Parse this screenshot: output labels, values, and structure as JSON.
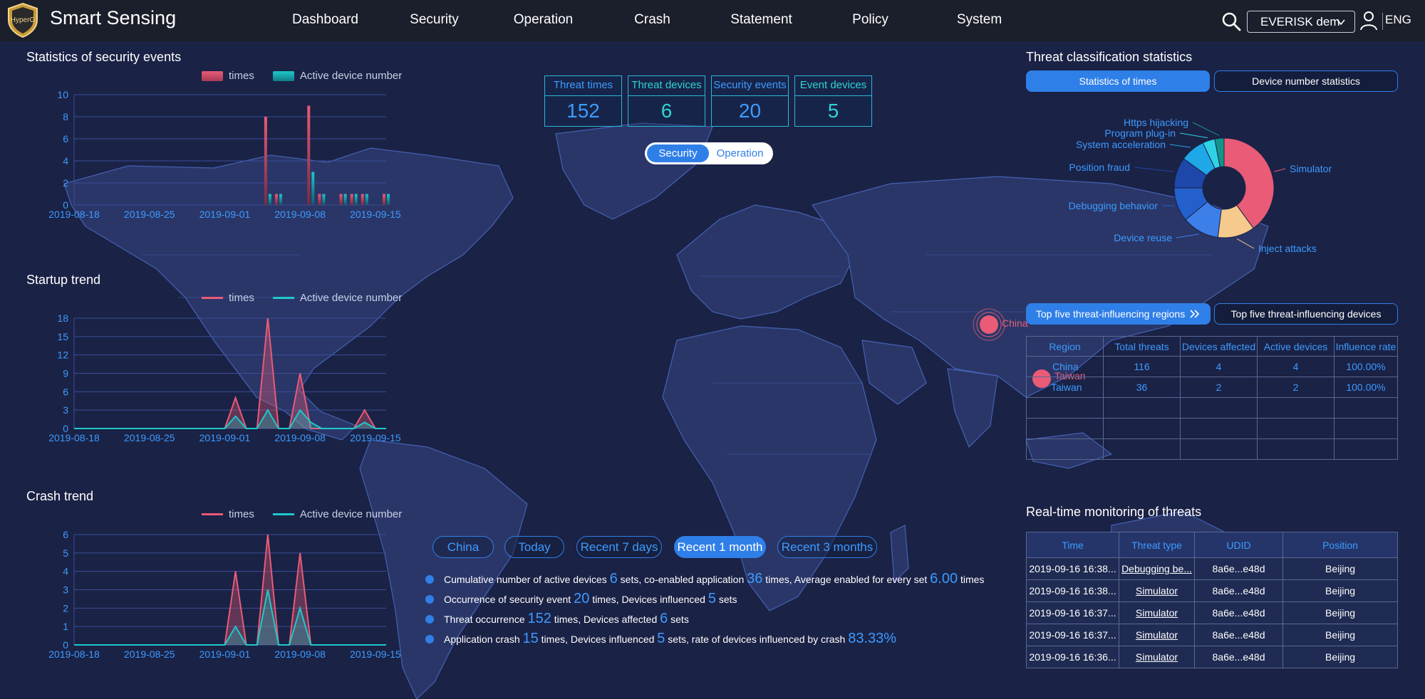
{
  "app": {
    "logo_text": "HyperG",
    "title": "Smart Sensing"
  },
  "nav": [
    "Dashboard",
    "Security",
    "Operation",
    "Crash",
    "Statement",
    "Policy",
    "System"
  ],
  "header": {
    "account": "EVERISK dem",
    "language": "ENG"
  },
  "colors": {
    "times": "#e95b76",
    "active": "#1ec9c9",
    "accent": "#2f7fe8",
    "background": "#1a2246",
    "topbar": "#1b1f2b"
  },
  "icons": [
    "logo-shield-icon",
    "search-icon",
    "chevron-down-icon",
    "user-icon"
  ],
  "sections": {
    "security_events": "Statistics of security events",
    "startup_trend": "Startup trend",
    "crash_trend": "Crash trend",
    "threat_classification": "Threat classification statistics",
    "realtime": "Real-time monitoring of threats"
  },
  "legend": {
    "times": "times",
    "active": "Active device number"
  },
  "kpis": [
    {
      "label": "Threat times",
      "value": "152",
      "style": "blue"
    },
    {
      "label": "Threat devices",
      "value": "6",
      "style": "teal"
    },
    {
      "label": "Security events",
      "value": "20",
      "style": "blue"
    },
    {
      "label": "Event devices",
      "value": "5",
      "style": "teal"
    }
  ],
  "mode_toggle": {
    "active": "Security",
    "inactive": "Operation"
  },
  "classification_tabs": {
    "active": "Statistics of times",
    "inactive": "Device number statistics"
  },
  "influence_tabs": {
    "active": "Top five threat-influencing regions",
    "inactive": "Top five threat-influencing devices"
  },
  "regions_table": {
    "headers": [
      "Region",
      "Total threats",
      "Devices affected",
      "Active devices",
      "Influence rate"
    ],
    "rows": [
      [
        "China",
        "116",
        "4",
        "4",
        "100.00%"
      ],
      [
        "Taiwan",
        "36",
        "2",
        "2",
        "100.00%"
      ],
      [
        "",
        "",
        "",
        "",
        ""
      ],
      [
        "",
        "",
        "",
        "",
        ""
      ],
      [
        "",
        "",
        "",
        "",
        ""
      ]
    ]
  },
  "monitor_table": {
    "headers": [
      "Time",
      "Threat type",
      "UDID",
      "Position"
    ],
    "rows": [
      [
        "2019-09-16 16:38...",
        "Debugging be...",
        "8a6e...e48d",
        "Beijing"
      ],
      [
        "2019-09-16 16:38...",
        "Simulator",
        "8a6e...e48d",
        "Beijing"
      ],
      [
        "2019-09-16 16:37...",
        "Simulator",
        "8a6e...e48d",
        "Beijing"
      ],
      [
        "2019-09-16 16:37...",
        "Simulator",
        "8a6e...e48d",
        "Beijing"
      ],
      [
        "2019-09-16 16:36...",
        "Simulator",
        "8a6e...e48d",
        "Beijing"
      ]
    ]
  },
  "filters": [
    "China",
    "Today",
    "Recent 7 days",
    "Recent 1 month",
    "Recent 3 months"
  ],
  "active_filter": "Recent 1 month",
  "summary": {
    "l1": {
      "a": "Cumulative number of active devices ",
      "n1": "6",
      "b": " sets, co-enabled application ",
      "n2": "36",
      "c": " times, Average enabled for every set ",
      "n3": "6.00",
      "d": " times"
    },
    "l2": {
      "a": "Occurrence of security event ",
      "n1": "20",
      "b": " times, Devices influenced ",
      "n2": "5",
      "c": " sets"
    },
    "l3": {
      "a": "Threat occurrence ",
      "n1": "152",
      "b": " times, Devices affected ",
      "n2": "6",
      "c": " sets"
    },
    "l4": {
      "a": "Application crash ",
      "n1": "15",
      "b": " times, Devices influenced ",
      "n2": "5",
      "c": " sets, rate of devices influenced by crash ",
      "n3": "83.33%"
    }
  },
  "map_markers": [
    {
      "label": "China"
    },
    {
      "label": "Taiwan"
    }
  ],
  "chart_data": [
    {
      "id": "security-events",
      "type": "bar",
      "title": "Statistics of security events",
      "x_tick_labels": [
        "2019-08-18",
        "2019-08-25",
        "2019-09-01",
        "2019-09-08",
        "2019-09-15"
      ],
      "x_range": [
        "2019-08-18",
        "2019-09-16"
      ],
      "ylim": [
        0,
        10
      ],
      "y_ticks": [
        0,
        2,
        4,
        6,
        8,
        10
      ],
      "series": [
        {
          "name": "times",
          "points": [
            [
              "2019-09-05",
              8
            ],
            [
              "2019-09-06",
              1
            ],
            [
              "2019-09-09",
              9
            ],
            [
              "2019-09-10",
              1
            ],
            [
              "2019-09-12",
              1
            ],
            [
              "2019-09-13",
              1
            ],
            [
              "2019-09-14",
              1
            ],
            [
              "2019-09-16",
              1
            ]
          ]
        },
        {
          "name": "Active device number",
          "points": [
            [
              "2019-09-05",
              1
            ],
            [
              "2019-09-06",
              1
            ],
            [
              "2019-09-09",
              3
            ],
            [
              "2019-09-10",
              1
            ],
            [
              "2019-09-12",
              1
            ],
            [
              "2019-09-13",
              1
            ],
            [
              "2019-09-14",
              1
            ],
            [
              "2019-09-16",
              1
            ]
          ]
        }
      ]
    },
    {
      "id": "startup-trend",
      "type": "area",
      "title": "Startup trend",
      "x_tick_labels": [
        "2019-08-18",
        "2019-08-25",
        "2019-09-01",
        "2019-09-08",
        "2019-09-15"
      ],
      "x_range": [
        "2019-08-18",
        "2019-09-16"
      ],
      "ylim": [
        0,
        18
      ],
      "y_ticks": [
        0,
        3,
        6,
        9,
        12,
        15,
        18
      ],
      "series": [
        {
          "name": "times",
          "points": [
            [
              "2019-08-18",
              0
            ],
            [
              "2019-09-01",
              0
            ],
            [
              "2019-09-02",
              5
            ],
            [
              "2019-09-03",
              0
            ],
            [
              "2019-09-04",
              0
            ],
            [
              "2019-09-05",
              18
            ],
            [
              "2019-09-06",
              0
            ],
            [
              "2019-09-07",
              0
            ],
            [
              "2019-09-08",
              9
            ],
            [
              "2019-09-09",
              0
            ],
            [
              "2019-09-13",
              0
            ],
            [
              "2019-09-14",
              3
            ],
            [
              "2019-09-15",
              0
            ],
            [
              "2019-09-16",
              0
            ]
          ]
        },
        {
          "name": "Active device number",
          "points": [
            [
              "2019-08-18",
              0
            ],
            [
              "2019-09-01",
              0
            ],
            [
              "2019-09-02",
              2
            ],
            [
              "2019-09-03",
              0
            ],
            [
              "2019-09-04",
              0
            ],
            [
              "2019-09-05",
              3
            ],
            [
              "2019-09-06",
              0
            ],
            [
              "2019-09-07",
              0
            ],
            [
              "2019-09-08",
              3
            ],
            [
              "2019-09-09",
              1
            ],
            [
              "2019-09-10",
              0
            ],
            [
              "2019-09-13",
              0
            ],
            [
              "2019-09-14",
              1
            ],
            [
              "2019-09-15",
              0
            ],
            [
              "2019-09-16",
              0
            ]
          ]
        }
      ]
    },
    {
      "id": "crash-trend",
      "type": "area",
      "title": "Crash trend",
      "x_tick_labels": [
        "2019-08-18",
        "2019-08-25",
        "2019-09-01",
        "2019-09-08",
        "2019-09-15"
      ],
      "x_range": [
        "2019-08-18",
        "2019-09-16"
      ],
      "ylim": [
        0,
        6
      ],
      "y_ticks": [
        0,
        1,
        2,
        3,
        4,
        5,
        6
      ],
      "series": [
        {
          "name": "times",
          "points": [
            [
              "2019-08-18",
              0
            ],
            [
              "2019-09-01",
              0
            ],
            [
              "2019-09-02",
              4
            ],
            [
              "2019-09-03",
              0
            ],
            [
              "2019-09-04",
              0
            ],
            [
              "2019-09-05",
              6
            ],
            [
              "2019-09-06",
              0
            ],
            [
              "2019-09-07",
              0
            ],
            [
              "2019-09-08",
              5
            ],
            [
              "2019-09-09",
              0
            ],
            [
              "2019-09-16",
              0
            ]
          ]
        },
        {
          "name": "Active device number",
          "points": [
            [
              "2019-08-18",
              0
            ],
            [
              "2019-09-01",
              0
            ],
            [
              "2019-09-02",
              1
            ],
            [
              "2019-09-03",
              0
            ],
            [
              "2019-09-04",
              0
            ],
            [
              "2019-09-05",
              3
            ],
            [
              "2019-09-06",
              0
            ],
            [
              "2019-09-07",
              0
            ],
            [
              "2019-09-08",
              2
            ],
            [
              "2019-09-09",
              0
            ],
            [
              "2019-09-16",
              0
            ]
          ]
        }
      ]
    },
    {
      "id": "threat-classification",
      "type": "pie",
      "title": "Threat classification statistics",
      "donut": true,
      "slices": [
        {
          "label": "Simulator",
          "value": 40,
          "color": "#e95b76"
        },
        {
          "label": "Inject attacks",
          "value": 12,
          "color": "#f6c98c"
        },
        {
          "label": "Device reuse",
          "value": 12,
          "color": "#3d7fe8"
        },
        {
          "label": "Debugging behavior",
          "value": 11,
          "color": "#2360cc"
        },
        {
          "label": "Position fraud",
          "value": 10,
          "color": "#1d47a8"
        },
        {
          "label": "System acceleration",
          "value": 8,
          "color": "#1fa8e8"
        },
        {
          "label": "Program plug-in",
          "value": 4,
          "color": "#2fd2e6"
        },
        {
          "label": "Https hijacking",
          "value": 3,
          "color": "#139488"
        }
      ]
    }
  ]
}
